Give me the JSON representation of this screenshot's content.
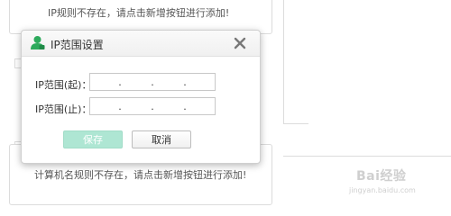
{
  "background": {
    "top_message": "IP规则不存在，请点击新增按钮进行添加!",
    "bottom_message": "计算机名规则不存在，请点击新增按钮进行添加!"
  },
  "dialog": {
    "title": "IP范围设置",
    "title_icon": "user-icon",
    "close_icon": "close-icon",
    "rows": [
      {
        "label": "IP范围(起)：",
        "value": " .  .  . "
      },
      {
        "label": "IP范围(止)：",
        "value": " .  .  . "
      }
    ],
    "save_label": "保存",
    "cancel_label": "取消"
  },
  "colors": {
    "accent": "#2daa5c",
    "save_button_bg": "#aee6d3",
    "border": "#dcdcdc"
  },
  "watermark": {
    "brand": "Bai经验",
    "url": "jingyan.baidu.com"
  }
}
